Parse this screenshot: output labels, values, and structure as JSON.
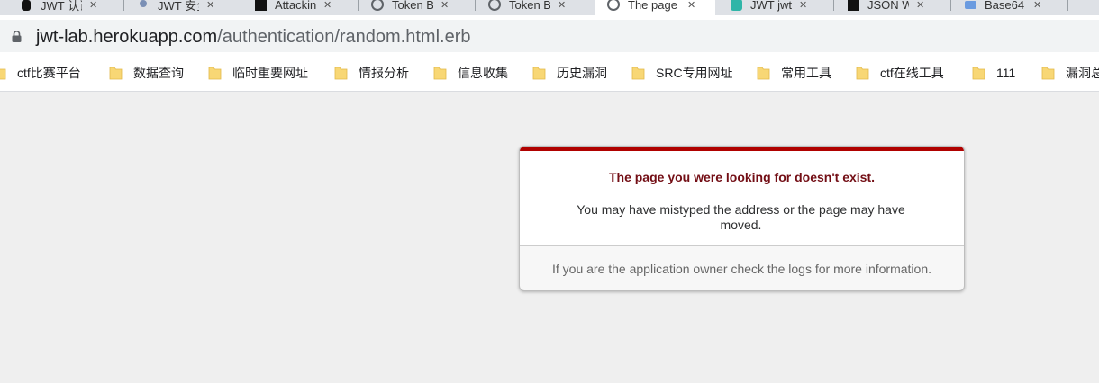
{
  "browser": {
    "tabs": [
      {
        "title": "JWT 认证",
        "icon": "apple-favicon-icon"
      },
      {
        "title": "JWT 安全",
        "icon": "user-favicon-icon"
      },
      {
        "title": "Attacking",
        "icon": "dark-favicon-icon"
      },
      {
        "title": "Token B",
        "icon": "globe-favicon-icon"
      },
      {
        "title": "Token B",
        "icon": "globe-favicon-icon"
      },
      {
        "title": "The page you",
        "icon": "globe-favicon-icon"
      },
      {
        "title": "JWT jwt",
        "icon": "teal-favicon-icon"
      },
      {
        "title": "JSON Web",
        "icon": "dark-favicon-icon"
      },
      {
        "title": "Base64",
        "icon": "blue-favicon-icon"
      }
    ],
    "tab_close_label": "✕",
    "url_host": "jwt-lab.herokuapp.com",
    "url_path": "/authentication/random.html.erb",
    "bookmarks": [
      "ctf比赛平台",
      "数据查询",
      "临时重要网址",
      "情报分析",
      "信息收集",
      "历史漏洞",
      "SRC专用网址",
      "常用工具",
      "ctf在线工具",
      "111",
      "漏洞总"
    ]
  },
  "error_page": {
    "title": "The page you were looking for doesn't exist.",
    "message": "You may have mistyped the address or the page may have moved.",
    "note": "If you are the application owner check the logs for more information."
  },
  "colors": {
    "accent_red": "#b00100",
    "title_red": "#730e15",
    "page_bg": "#efefef",
    "folder_yellow": "#f8d775"
  }
}
